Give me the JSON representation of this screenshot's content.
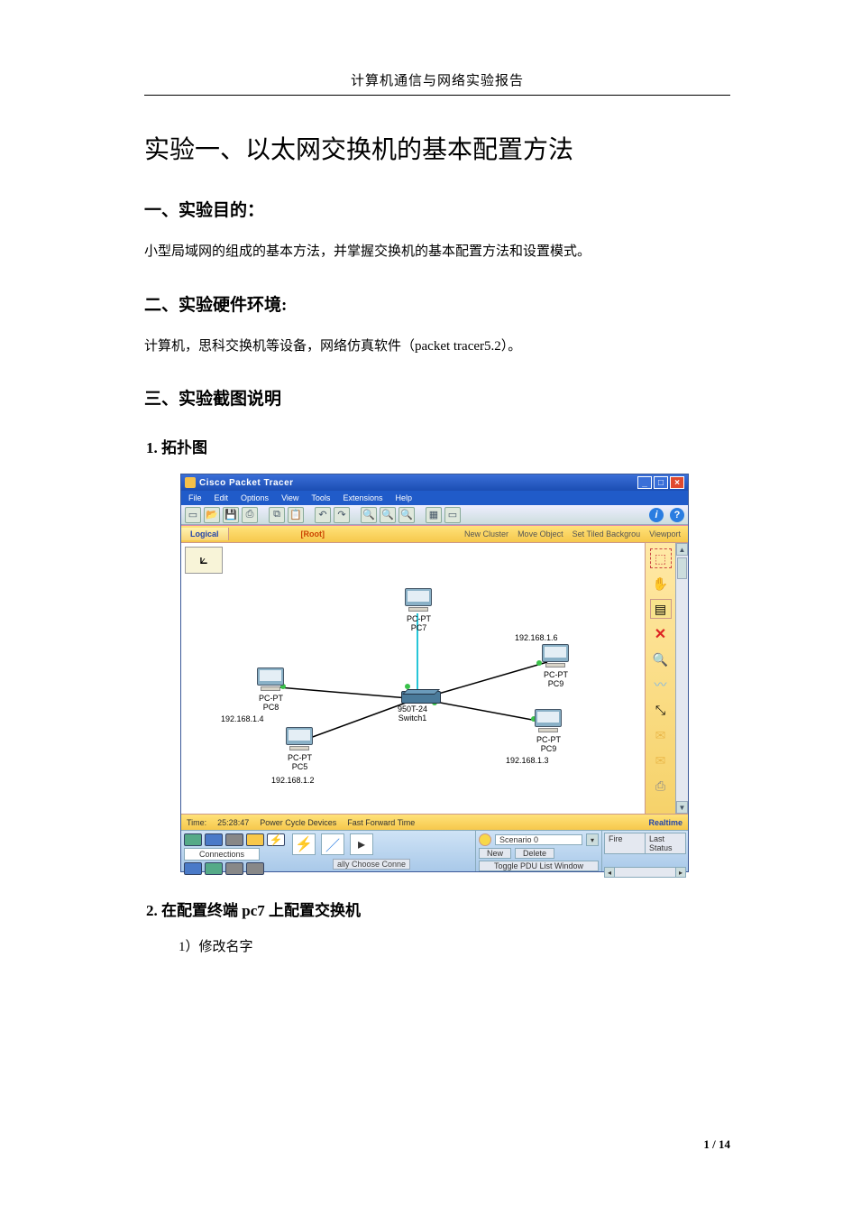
{
  "doc": {
    "header": "计算机通信与网络实验报告",
    "title": "实验一、以太网交换机的基本配置方法",
    "s1_heading": "一、实验目的：",
    "s1_body": "小型局域网的组成的基本方法，并掌握交换机的基本配置方法和设置模式。",
    "s2_heading": "二、实验硬件环境:",
    "s2_body": "计算机，思科交换机等设备，网络仿真软件（packet tracer5.2）。",
    "s3_heading": "三、实验截图说明",
    "s3_1": "1.  拓扑图",
    "s3_2": "2.  在配置终端 pc7 上配置交换机",
    "s3_2_1": "1）修改名字",
    "page_num": "1 / 14"
  },
  "pt": {
    "title": "Cisco Packet Tracer",
    "menus": [
      "File",
      "Edit",
      "Options",
      "View",
      "Tools",
      "Extensions",
      "Help"
    ],
    "tab_logical": "Logical",
    "root": "[Root]",
    "tabbar_right": [
      "New Cluster",
      "Move Object",
      "Set Tiled Backgrou",
      "Viewport"
    ],
    "status_time_label": "Time:",
    "status_time": "25:28:47",
    "status_items": [
      "Power Cycle Devices",
      "Fast Forward Time"
    ],
    "realtime": "Realtime",
    "connections_label": "Connections",
    "footer_txt": "ally Choose Conne",
    "scenario_label": "Scenario 0",
    "btn_new": "New",
    "btn_delete": "Delete",
    "btn_toggle": "Toggle PDU List Window",
    "th_fire": "Fire",
    "th_last": "Last Status",
    "devices": {
      "pc7": {
        "label1": "PC-PT",
        "label2": "PC7"
      },
      "pc8": {
        "label1": "PC-PT",
        "label2": "PC8",
        "ip": "192.168.1.4"
      },
      "pc5": {
        "label1": "PC-PT",
        "label2": "PC5",
        "ip": "192.168.1.2"
      },
      "pc9a": {
        "label1": "PC-PT",
        "label2": "PC9",
        "ip": "192.168.1.6"
      },
      "pc9b": {
        "label1": "PC-PT",
        "label2": "PC9",
        "ip": "192.168.1.3"
      },
      "switch": {
        "label1": "950T-24",
        "label2": "Switch1"
      }
    }
  }
}
